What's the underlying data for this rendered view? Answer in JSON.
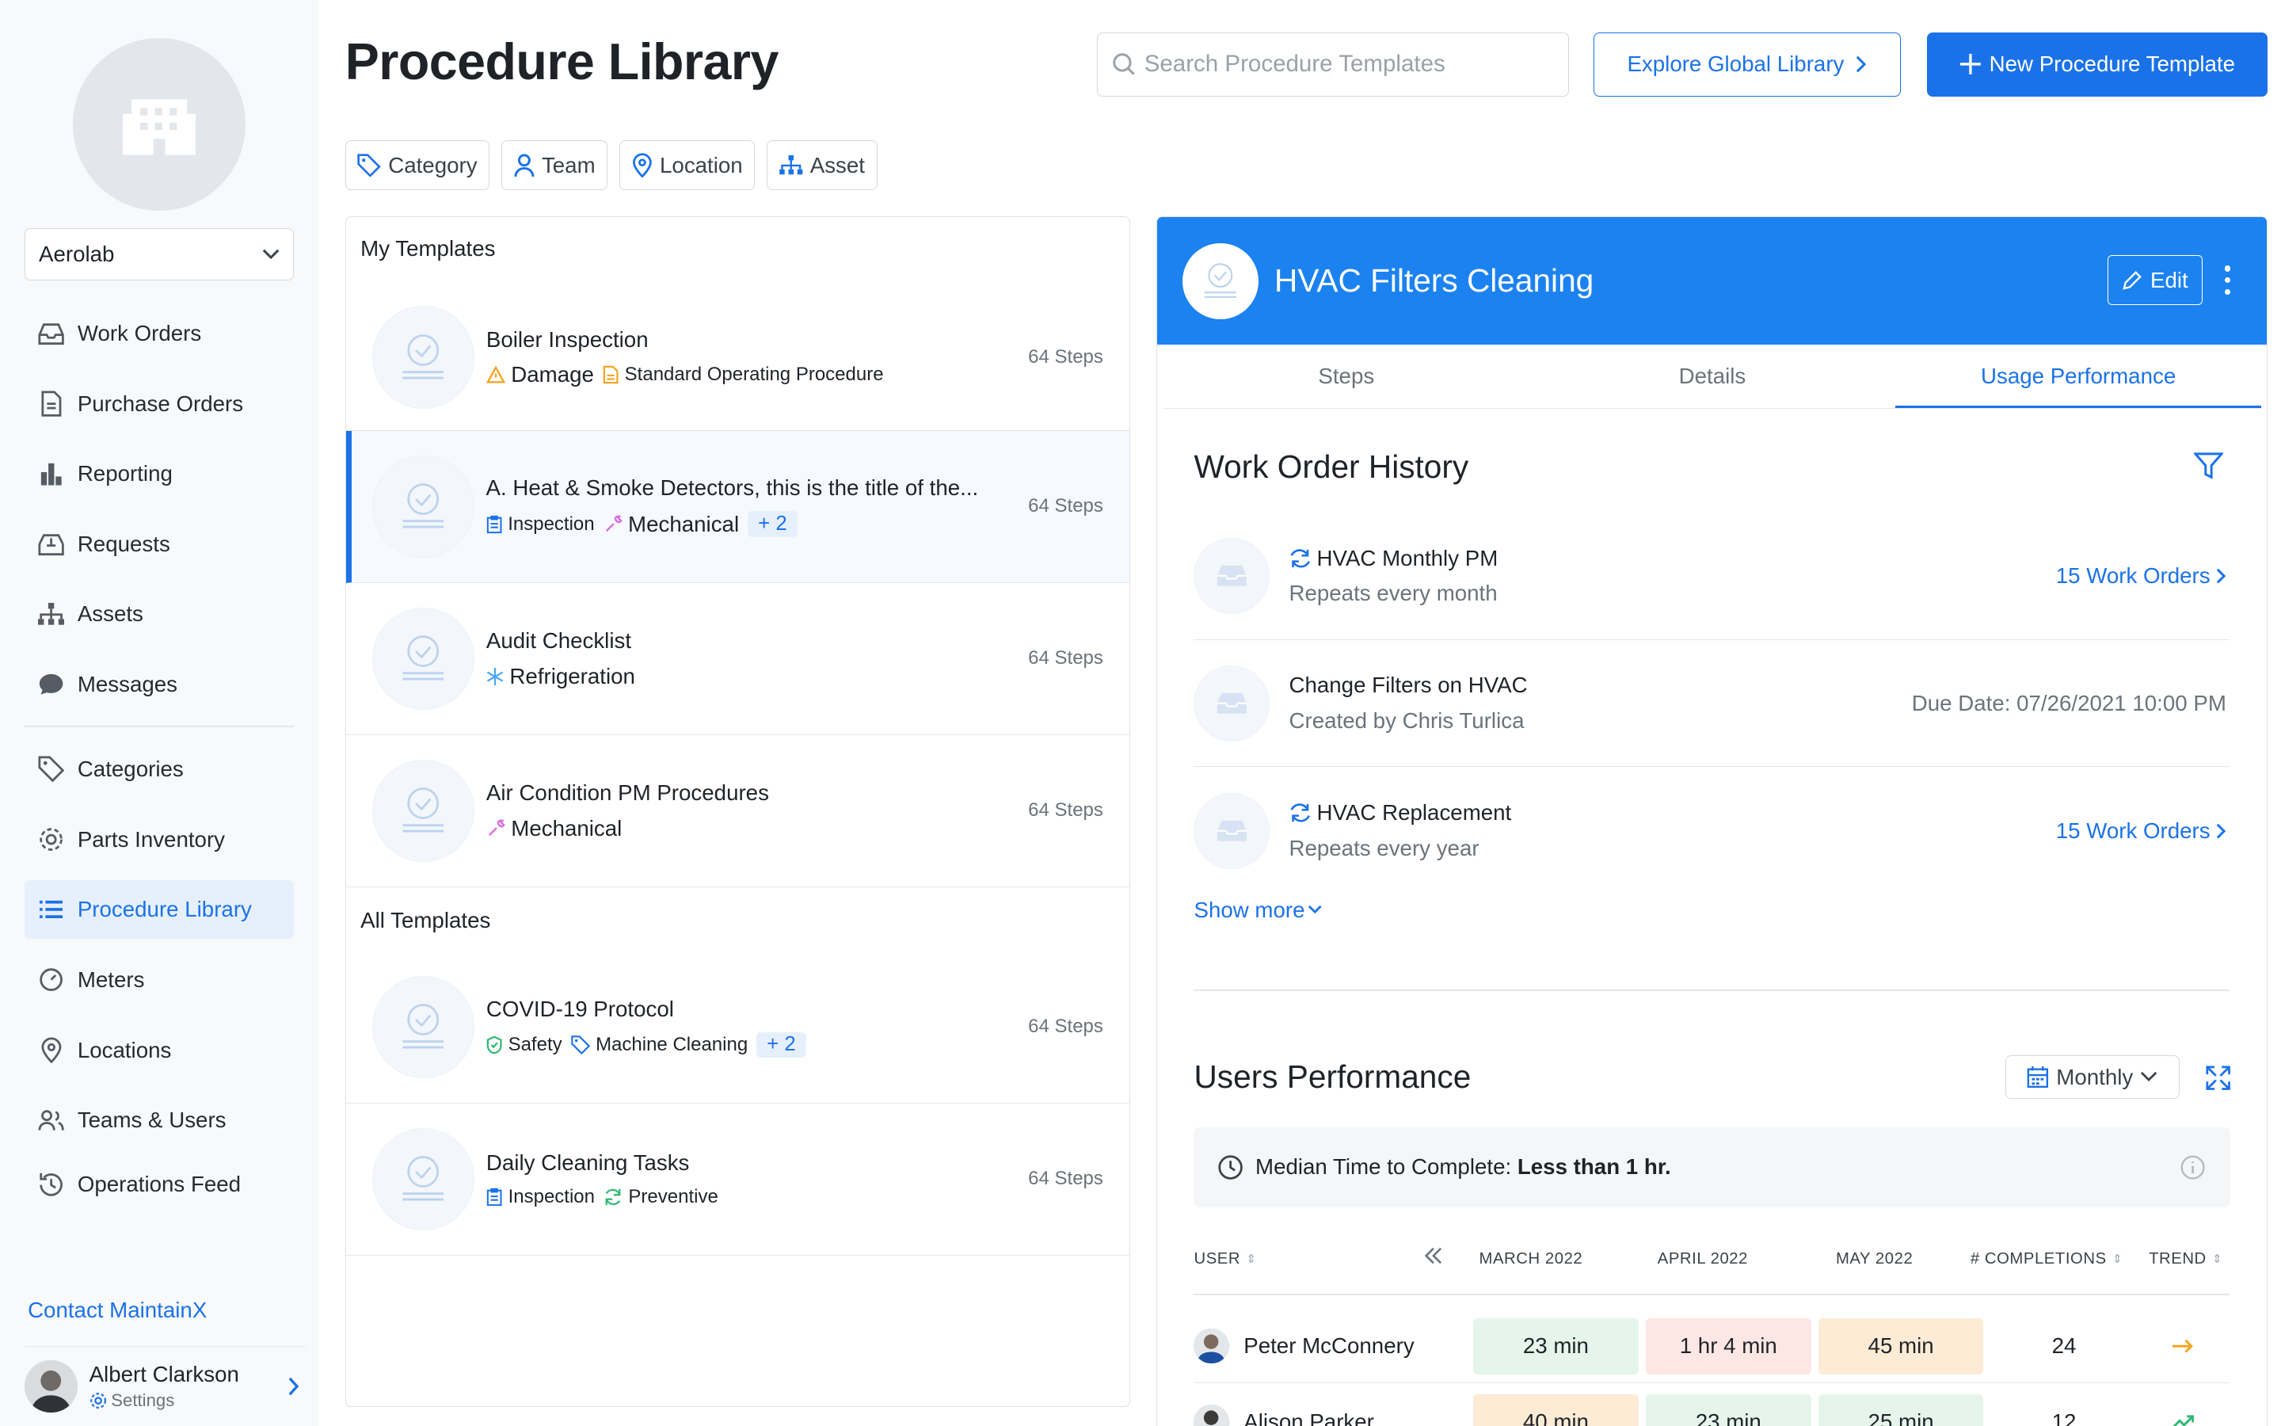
{
  "sidebar": {
    "org_name": "Aerolab",
    "nav_primary": [
      {
        "label": "Work Orders",
        "icon": "inbox-icon"
      },
      {
        "label": "Purchase Orders",
        "icon": "document-icon"
      },
      {
        "label": "Reporting",
        "icon": "bar-chart-icon"
      },
      {
        "label": "Requests",
        "icon": "tray-download-icon"
      },
      {
        "label": "Assets",
        "icon": "hierarchy-icon"
      },
      {
        "label": "Messages",
        "icon": "chat-icon"
      }
    ],
    "nav_secondary": [
      {
        "label": "Categories",
        "icon": "tag-icon"
      },
      {
        "label": "Parts Inventory",
        "icon": "gear-icon"
      },
      {
        "label": "Procedure Library",
        "icon": "list-icon",
        "active": true
      },
      {
        "label": "Meters",
        "icon": "gauge-icon"
      },
      {
        "label": "Locations",
        "icon": "pin-icon"
      },
      {
        "label": "Teams & Users",
        "icon": "users-icon"
      },
      {
        "label": "Operations Feed",
        "icon": "history-icon"
      }
    ],
    "contact": "Contact MaintainX",
    "user": {
      "name": "Albert Clarkson",
      "settings": "Settings"
    }
  },
  "header": {
    "title": "Procedure Library",
    "search_placeholder": "Search Procedure Templates",
    "explore_label": "Explore Global Library",
    "new_label": "New Procedure Template"
  },
  "filters": [
    {
      "label": "Category",
      "icon": "tag-icon"
    },
    {
      "label": "Team",
      "icon": "user-icon"
    },
    {
      "label": "Location",
      "icon": "pin-icon"
    },
    {
      "label": "Asset",
      "icon": "hierarchy-icon"
    }
  ],
  "templates": {
    "my_label": "My Templates",
    "all_label": "All Templates",
    "steps_label": "64 Steps",
    "my": [
      {
        "title": "Boiler Inspection",
        "tags": [
          {
            "label": "Damage",
            "icon": "warning-icon",
            "big": true
          },
          {
            "label": "Standard Operating Procedure",
            "icon": "document-icon"
          }
        ]
      },
      {
        "title": "A. Heat & Smoke Detectors, this is the title of the...",
        "tags": [
          {
            "label": "Inspection",
            "icon": "clipboard-icon"
          },
          {
            "label": "Mechanical",
            "icon": "wrench-icon",
            "big": true
          }
        ],
        "extra": "+ 2",
        "selected": true
      },
      {
        "title": "Audit Checklist",
        "tags": [
          {
            "label": "Refrigeration",
            "icon": "snowflake-icon",
            "big": true
          }
        ]
      },
      {
        "title": "Air Condition PM Procedures",
        "tags": [
          {
            "label": "Mechanical",
            "icon": "wrench-icon",
            "big": true
          }
        ]
      }
    ],
    "all": [
      {
        "title": "COVID-19 Protocol",
        "tags": [
          {
            "label": "Safety",
            "icon": "shield-icon"
          },
          {
            "label": "Machine Cleaning",
            "icon": "tag-icon"
          }
        ],
        "extra": "+ 2"
      },
      {
        "title": "Daily Cleaning Tasks",
        "tags": [
          {
            "label": "Inspection",
            "icon": "clipboard-icon"
          },
          {
            "label": "Preventive",
            "icon": "refresh-icon"
          }
        ]
      }
    ]
  },
  "detail": {
    "title": "HVAC Filters Cleaning",
    "edit_label": "Edit",
    "tabs": [
      "Steps",
      "Details",
      "Usage Performance"
    ],
    "active_tab": "Usage Performance",
    "work_order_history": {
      "title": "Work Order History",
      "rows": [
        {
          "title": "HVAC Monthly PM",
          "sub": "Repeats every month",
          "right": "15 Work Orders",
          "recurring": true
        },
        {
          "title": "Change Filters on HVAC",
          "sub": "Created by Chris Turlica",
          "right": "Due Date: 07/26/2021 10:00 PM",
          "recurring": false
        },
        {
          "title": "HVAC Replacement",
          "sub": "Repeats every year",
          "right": "15 Work Orders",
          "recurring": true
        }
      ],
      "show_more": "Show more"
    },
    "users_performance": {
      "title": "Users Performance",
      "period": "Monthly",
      "median_label": "Median Time to Complete:",
      "median_value": "Less than 1 hr.",
      "columns": {
        "user": "USER",
        "m1": "MARCH 2022",
        "m2": "APRIL 2022",
        "m3": "MAY 2022",
        "completions": "# COMPLETIONS",
        "trend": "TREND"
      },
      "rows": [
        {
          "name": "Peter McConnery",
          "m1": "23 min",
          "m2": "1 hr 4 min",
          "m3": "45 min",
          "completions": "24",
          "trend": "flat",
          "colors": [
            "green",
            "red",
            "orange"
          ]
        },
        {
          "name": "Alison Parker",
          "m1": "40 min",
          "m2": "23 min",
          "m3": "25 min",
          "completions": "12",
          "trend": "up",
          "colors": [
            "orange",
            "green",
            "green"
          ]
        }
      ]
    }
  },
  "colors": {
    "accent": "#1b72e8",
    "header_blue": "#1b82f0"
  }
}
